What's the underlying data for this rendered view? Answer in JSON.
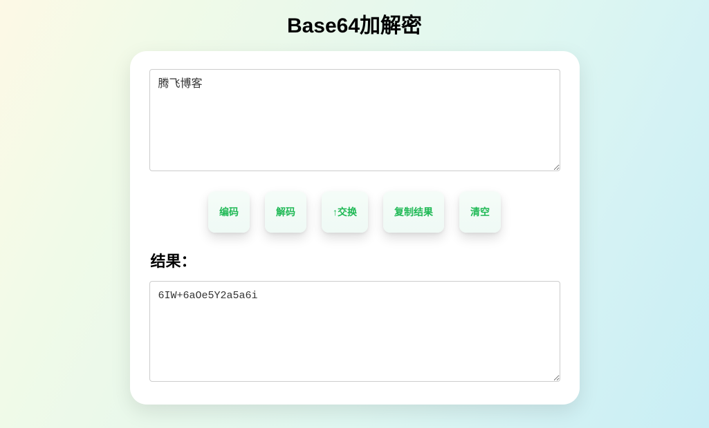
{
  "page": {
    "title": "Base64加解密"
  },
  "input": {
    "value": "腾飞博客"
  },
  "buttons": {
    "encode": "编码",
    "decode": "解码",
    "swap": "↑交换",
    "copy": "复制结果",
    "clear": "清空"
  },
  "result": {
    "label": "结果：",
    "value": "6IW+6aOe5Y2a5a6i"
  }
}
